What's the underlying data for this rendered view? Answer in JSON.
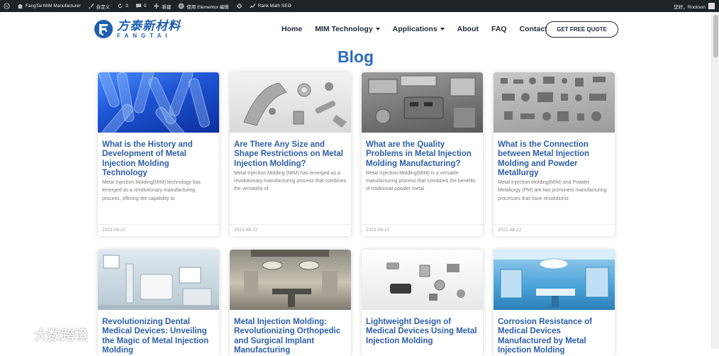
{
  "adminbar": {
    "site_name": "FangTai MIM Manufacturer",
    "customize": "自定义",
    "updates_count": "3",
    "comments_count": "0",
    "new": "新建",
    "elementor": "使用 Elementor 编辑",
    "rank_math": "Rank Math SEO",
    "greeting": "您好，Rockson"
  },
  "header": {
    "logo_cn": "方泰新材料",
    "logo_en": "FANGTAI",
    "nav": [
      {
        "label": "Home",
        "has_caret": false
      },
      {
        "label": "MIM Technology",
        "has_caret": true
      },
      {
        "label": "Applications",
        "has_caret": true
      },
      {
        "label": "About",
        "has_caret": false
      },
      {
        "label": "FAQ",
        "has_caret": false
      },
      {
        "label": "Contact",
        "has_caret": false
      }
    ],
    "quote_button": "GET FREE QUOTE"
  },
  "page": {
    "title": "Blog"
  },
  "posts": [
    {
      "title": "What is the History and Development of Metal Injection Molding Technology",
      "excerpt": "Metal Injection Molding(MIM) technology has emerged as a revolutionary manufacturing process, offering the capability to",
      "date": "2023-08-22"
    },
    {
      "title": "Are There Any Size and Shape Restrictions on Metal Injection Molding?",
      "excerpt": "Metal Injection Molding (MIM) has emerged as a revolutionary manufacturing process that combines the versatility of",
      "date": "2023-08-22"
    },
    {
      "title": "What are the Quality Problems in Metal Injection Molding Manufacturing?",
      "excerpt": "Metal Injection Molding(MIM) is a versatile manufacturing process that combines the benefits of traditional powder metal",
      "date": "2023-08-22"
    },
    {
      "title": "What is the Connection between Metal Injection Molding and Powder Metallurgy",
      "excerpt": "Metal Injection Molding(MIM) and Powder Metallurgy (PM) are two prominent manufacturing processes that have revolutioniz",
      "date": "2021-08-22"
    },
    {
      "title": "Revolutionizing Dental Medical Devices: Unveiling the Magic of Metal Injection Molding"
    },
    {
      "title": "Metal Injection Molding: Revolutionizing Orthopedic and Surgical Implant Manufacturing"
    },
    {
      "title": "Lightweight Design of Medical Devices Using Metal Injection Molding"
    },
    {
      "title": "Corrosion Resistance of Medical Devices Manufactured by Metal Injection Molding"
    }
  ],
  "watermark": "大数跨境",
  "colors": {
    "adminbar": "#1d2327",
    "brand_blue": "#1f5fb0",
    "title_blue": "#2d6cc0",
    "card_title": "#2d5fa8"
  }
}
